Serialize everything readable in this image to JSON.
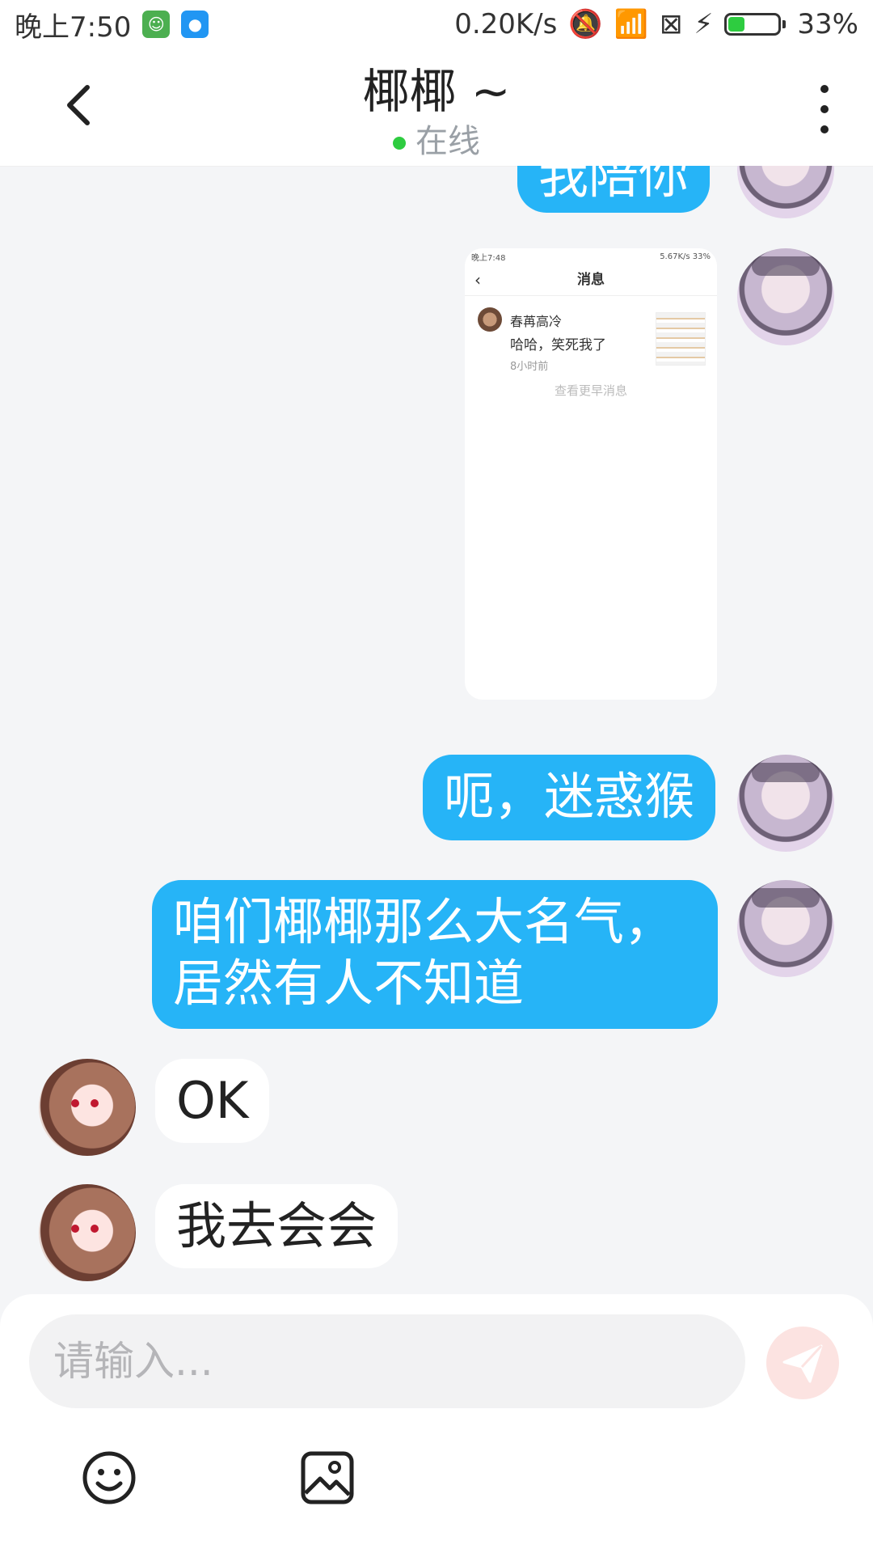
{
  "status_bar": {
    "time": "晚上7:50",
    "speed": "0.20K/s",
    "battery_percent": "33%",
    "battery_level": 0.33
  },
  "header": {
    "title": "椰椰 ~",
    "status": "在线",
    "back_icon": "chevron-left-icon",
    "more_icon": "more-vertical-icon"
  },
  "messages": [
    {
      "from": "me",
      "text": "我陪你"
    },
    {
      "from": "me",
      "type": "image"
    },
    {
      "from": "me",
      "text": "呃，迷惑猴"
    },
    {
      "from": "me",
      "text_lines": [
        "咱们椰椰那么大名气，",
        "居然有人不知道"
      ]
    },
    {
      "from": "peer",
      "text": "OK"
    },
    {
      "from": "peer",
      "text": "我去会会"
    }
  ],
  "screenshot": {
    "status_time": "晚上7:48",
    "status_right": "5.67K/s  33%",
    "title": "消息",
    "item": {
      "name": "春苒高冷",
      "message": "哈哈，笑死我了",
      "time": "8小时前"
    },
    "more_link": "查看更早消息"
  },
  "input": {
    "placeholder": "请输入...",
    "send_icon": "send-icon",
    "emoji_icon": "emoji-icon",
    "image_icon": "image-icon"
  },
  "colors": {
    "accent": "#26b4f7",
    "online": "#2ecc40",
    "send_disabled": "#fce3e1"
  }
}
